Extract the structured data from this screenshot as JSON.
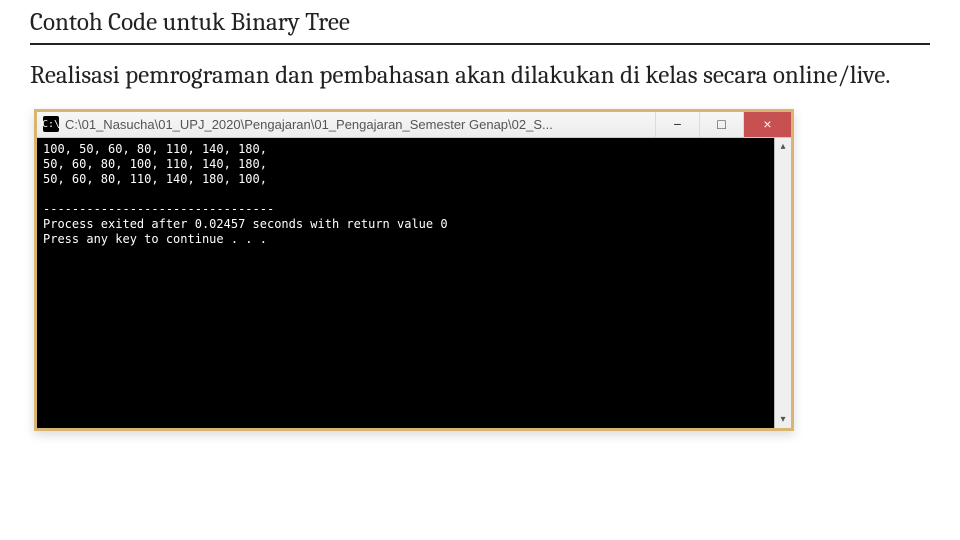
{
  "heading": "Contoh Code untuk Binary Tree",
  "body_text": "Realisasi pemrograman dan pembahasan akan dilakukan di kelas secara online/live.",
  "window": {
    "icon_glyph": "C:\\",
    "title": "C:\\01_Nasucha\\01_UPJ_2020\\Pengajaran\\01_Pengajaran_Semester Genap\\02_S...",
    "controls": {
      "minimize": "−",
      "maximize": "□",
      "close": "×"
    },
    "scrollbar": {
      "up": "▴",
      "down": "▾"
    }
  },
  "console_lines": [
    "100, 50, 60, 80, 110, 140, 180,",
    "50, 60, 80, 100, 110, 140, 180,",
    "50, 60, 80, 110, 140, 180, 100,",
    "",
    "--------------------------------",
    "Process exited after 0.02457 seconds with return value 0",
    "Press any key to continue . . ."
  ]
}
